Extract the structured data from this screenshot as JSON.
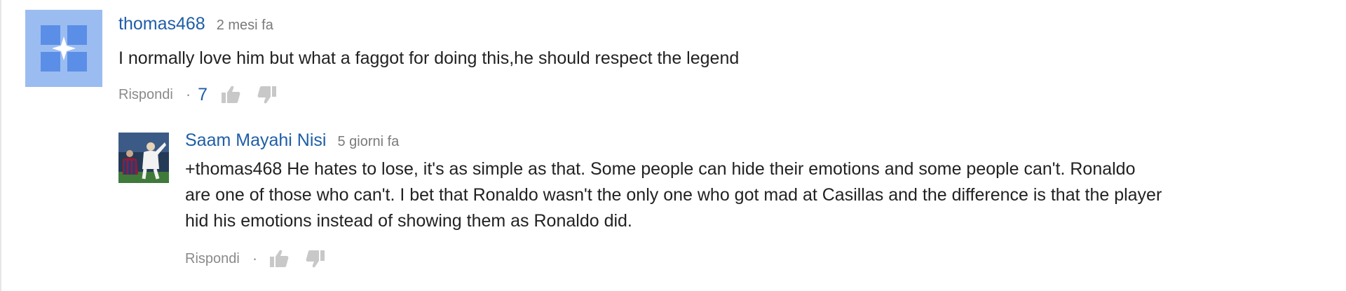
{
  "comments": [
    {
      "author": "thomas468",
      "time": "2 mesi fa",
      "text": "I normally love him but what a faggot for doing this,he should respect the legend",
      "actions": {
        "reply_label": "Rispondi",
        "separator": "·",
        "like_count": "7"
      },
      "avatar_icon": "default-avatar-icon"
    }
  ],
  "replies": [
    {
      "author": "Saam Mayahi Nisi",
      "time": "5 giorni fa",
      "text_lines": [
        "+thomas468 He hates to lose, it's as simple as that. Some people can hide their emotions and some people can't. Ronaldo",
        "are one of those who can't. I bet that Ronaldo wasn't the only one who got mad at Casillas and the difference is that the player",
        "hid his emotions instead of showing them as Ronaldo did."
      ],
      "actions": {
        "reply_label": "Rispondi",
        "separator": "·"
      },
      "avatar_icon": "football-photo-avatar"
    }
  ],
  "icons": {
    "like": "thumbs-up-icon",
    "dislike": "thumbs-down-icon"
  },
  "colors": {
    "author": "#1f5ea8",
    "text": "#222222",
    "meta": "#7a7a7a",
    "default_avatar_bg": "#9bbcf0",
    "default_avatar_fg": "#ffffff"
  }
}
